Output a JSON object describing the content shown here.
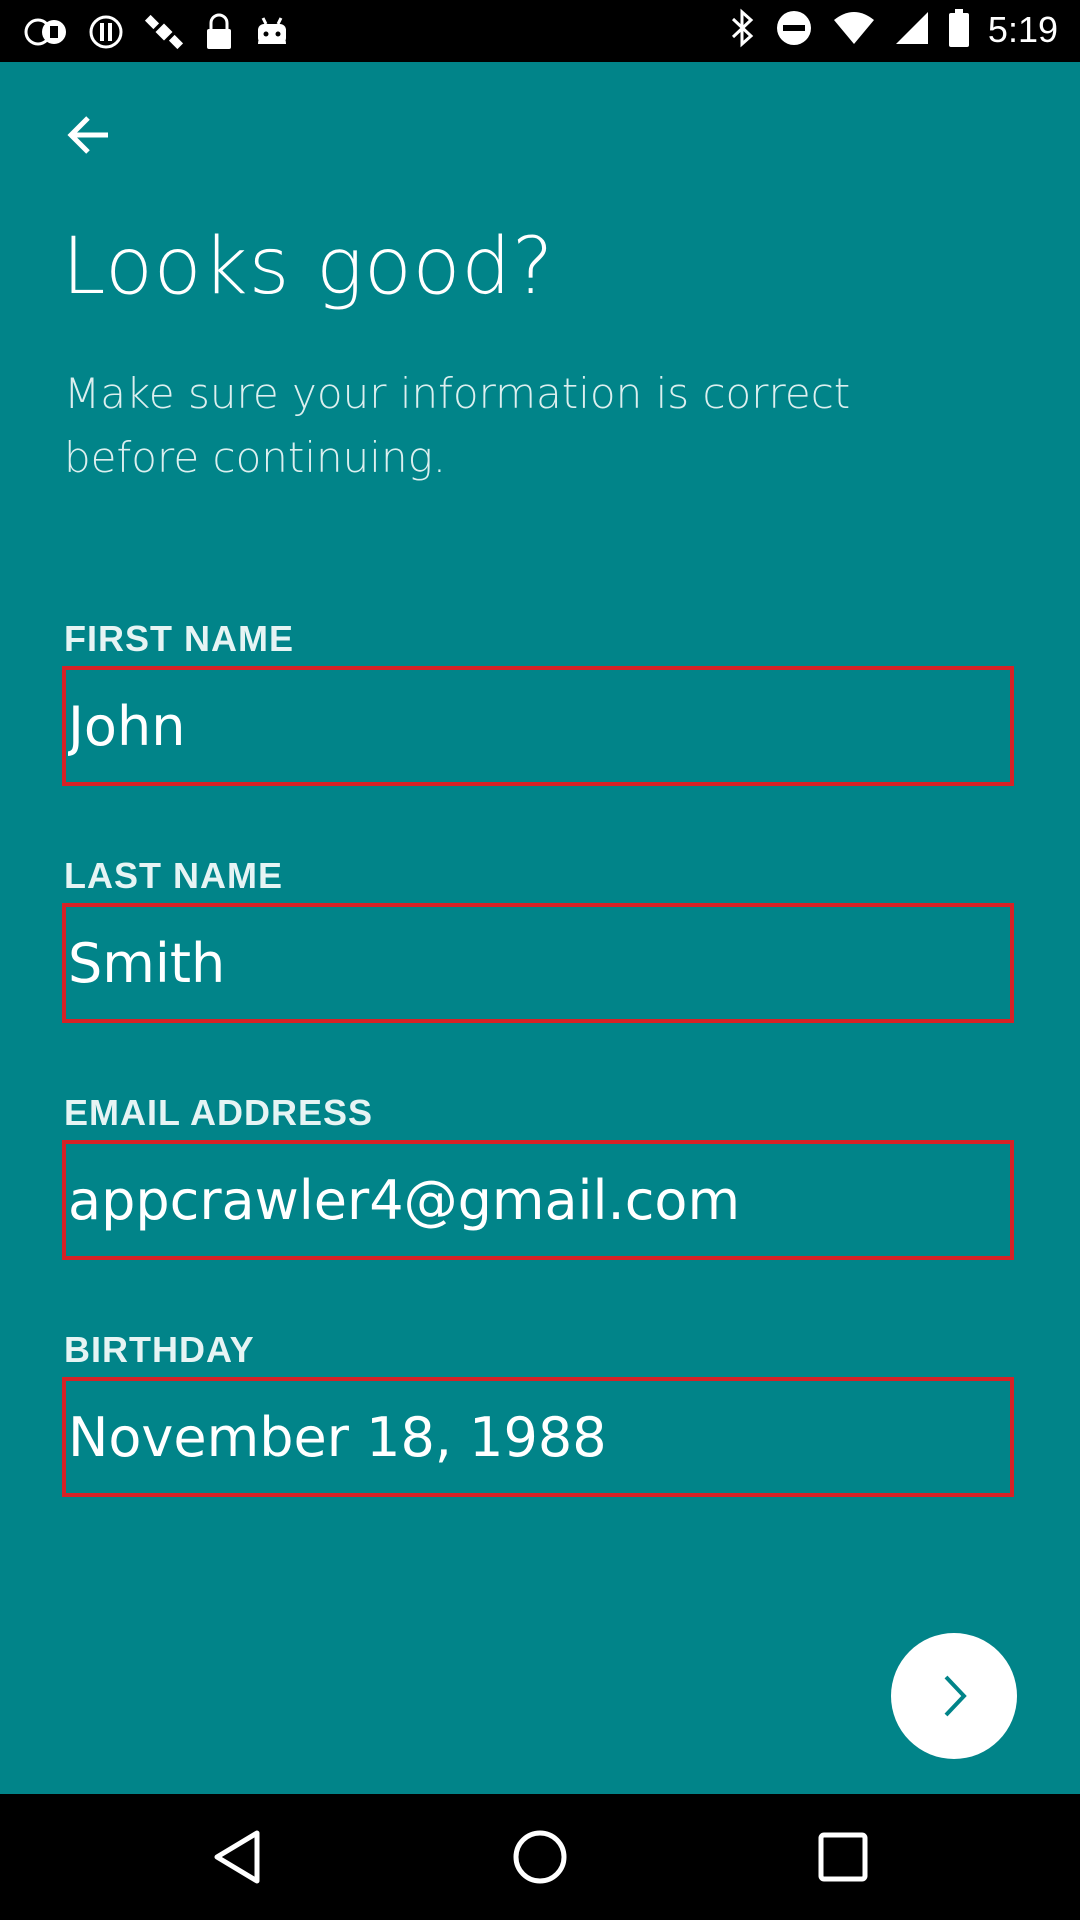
{
  "status_bar": {
    "time": "5:19",
    "notification_icons": [
      "abc13-icon",
      "alert-icon",
      "satellite-icon",
      "lock-icon",
      "android-icon"
    ],
    "system_icons": [
      "bluetooth-icon",
      "do-not-disturb-icon",
      "wifi-icon",
      "signal-icon",
      "battery-icon"
    ]
  },
  "header": {
    "title": "Looks good?",
    "subtitle": "Make sure your information is correct before continuing."
  },
  "form": {
    "first_name": {
      "label": "FIRST NAME",
      "value": "John"
    },
    "last_name": {
      "label": "LAST NAME",
      "value": "Smith"
    },
    "email": {
      "label": "EMAIL ADDRESS",
      "value": "appcrawler4@gmail.com"
    },
    "birthday": {
      "label": "BIRTHDAY",
      "value": "November 18, 1988"
    }
  },
  "colors": {
    "background": "#018489",
    "field_border": "#d62226",
    "next_button": "#ffffff",
    "next_arrow": "#018489"
  }
}
